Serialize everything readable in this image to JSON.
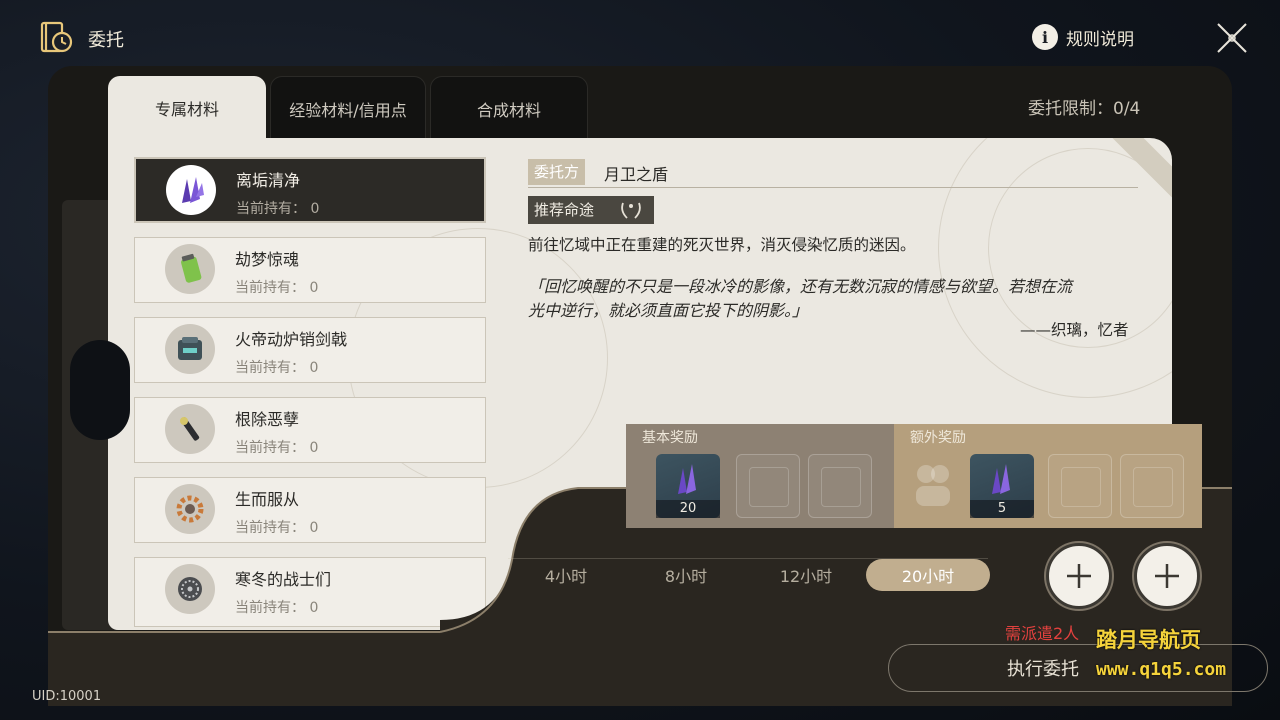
{
  "header": {
    "title": "委托",
    "rules_label": "规则说明"
  },
  "tabs": [
    {
      "label": "专属材料",
      "active": true
    },
    {
      "label": "经验材料/信用点",
      "active": false
    },
    {
      "label": "合成材料",
      "active": false
    }
  ],
  "limit_text": "委托限制：0/4",
  "list": [
    {
      "name": "离垢清净",
      "holding": "当前持有： 0",
      "selected": true,
      "icon": "purple-crystal-icon"
    },
    {
      "name": "劫梦惊魂",
      "holding": "当前持有： 0",
      "selected": false,
      "icon": "green-canister-icon"
    },
    {
      "name": "火帝动炉销剑戟",
      "holding": "当前持有： 0",
      "selected": false,
      "icon": "furnace-icon"
    },
    {
      "name": "根除恶孽",
      "holding": "当前持有： 0",
      "selected": false,
      "icon": "wrench-icon"
    },
    {
      "name": "生而服从",
      "holding": "当前持有： 0",
      "selected": false,
      "icon": "gear-icon"
    },
    {
      "name": "寒冬的战士们",
      "holding": "当前持有： 0",
      "selected": false,
      "icon": "fan-icon"
    }
  ],
  "detail": {
    "client_tag": "委托方",
    "client_name": "月卫之盾",
    "path_tag": "推荐命途",
    "path_icon": "laurel-icon",
    "description": "前往忆域中正在重建的死灭世界，消灭侵染忆质的迷因。",
    "quote_line1": "「回忆唤醒的不只是一段冰冷的影像，还有无数沉寂的情感与欲望。若想在流",
    "quote_line2": "光中逆行，就必须直面它投下的阴影。」",
    "quote_author": "——织璃，忆者"
  },
  "rewards": {
    "base_title": "基本奖励",
    "base_count": "20",
    "extra_title": "额外奖励",
    "extra_count": "5"
  },
  "durations": [
    {
      "label": "4小时",
      "active": false
    },
    {
      "label": "8小时",
      "active": false
    },
    {
      "label": "12小时",
      "active": false
    },
    {
      "label": "20小时",
      "active": true
    }
  ],
  "dispatch_note": "需派遣2人",
  "execute_label": "执行委托",
  "watermark_line1": "踏月导航页",
  "watermark_line2": "www.q1q5.com",
  "uid": "UID:10001"
}
